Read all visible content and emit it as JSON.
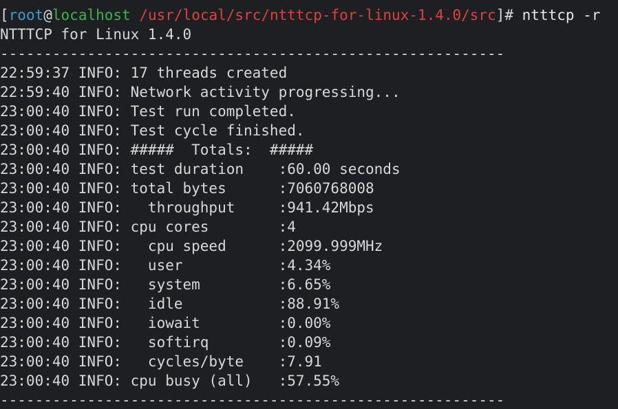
{
  "prompt": {
    "open_bracket": "[",
    "user": "root",
    "at": "@",
    "host": "localhost",
    "path": "/usr/local/src/ntttcp-for-linux-1.4.0/src",
    "close": "]# ",
    "command": "ntttcp -r"
  },
  "header": "NTTTCP for Linux 1.4.0",
  "separator": "----------------------------------------------------------",
  "log_lines": [
    "22:59:37 INFO: 17 threads created",
    "22:59:40 INFO: Network activity progressing...",
    "23:00:40 INFO: Test run completed.",
    "23:00:40 INFO: Test cycle finished.",
    "23:00:40 INFO: #####  Totals:  #####",
    "23:00:40 INFO: test duration    :60.00 seconds",
    "23:00:40 INFO: total bytes      :7060768008",
    "23:00:40 INFO:   throughput     :941.42Mbps",
    "23:00:40 INFO: cpu cores        :4",
    "23:00:40 INFO:   cpu speed      :2099.999MHz",
    "23:00:40 INFO:   user           :4.34%",
    "23:00:40 INFO:   system         :6.65%",
    "23:00:40 INFO:   idle           :88.91%",
    "23:00:40 INFO:   iowait         :0.00%",
    "23:00:40 INFO:   softirq        :0.09%",
    "23:00:40 INFO:   cycles/byte    :7.91",
    "23:00:40 INFO: cpu busy (all)   :57.55%"
  ],
  "footer_separator": "----------------------------------------------------------",
  "colors": {
    "background": "#1e1f22",
    "text": "#d8d8d8",
    "user": "#3e9bd6",
    "host": "#39b54a",
    "path": "#e0413b"
  }
}
